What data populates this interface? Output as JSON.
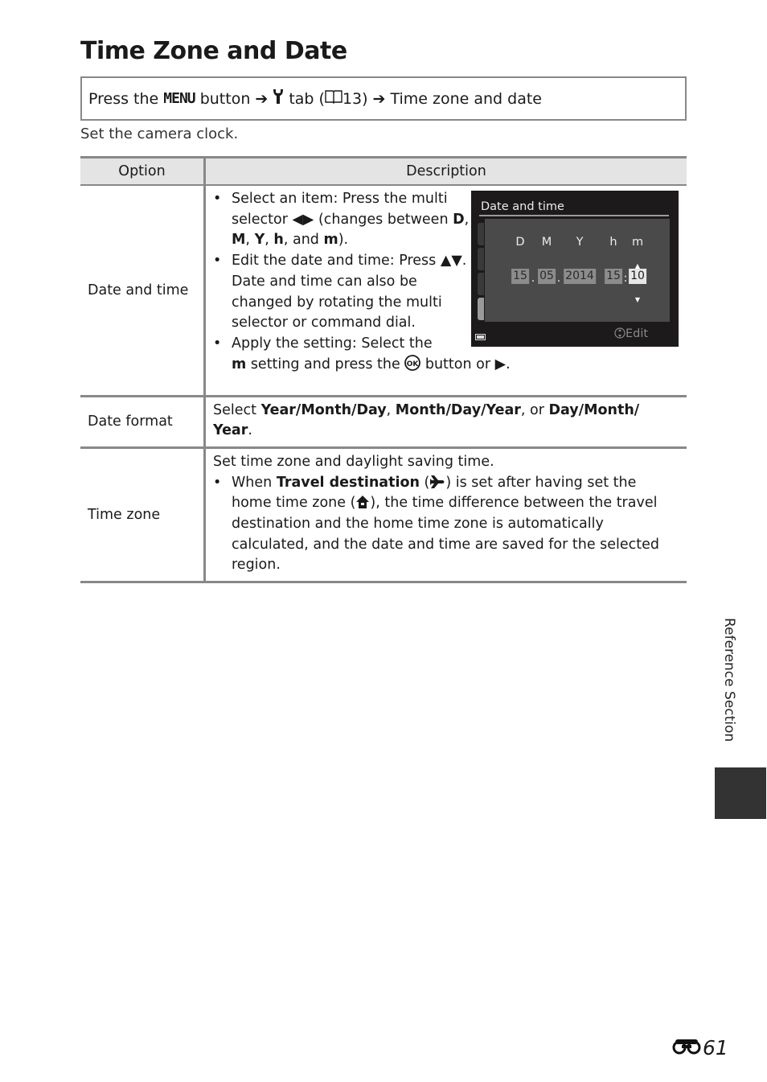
{
  "page": {
    "title": "Time Zone and Date",
    "nav_path": {
      "prefix": "Press the",
      "menu_word": "MENU",
      "button_word": "button",
      "arrow": "➔",
      "tab_icon": "wrench-icon",
      "tab_word": "tab (",
      "book_icon": "book-reference-icon",
      "page_ref": "13)",
      "destination": "Time zone and date"
    },
    "intro": "Set the camera clock.",
    "side_label": "Reference Section",
    "page_number": "61",
    "page_prefix_icon": "binoculars-icon"
  },
  "table": {
    "headers": [
      "Option",
      "Description"
    ],
    "rows": [
      {
        "option": "Date and time",
        "bullets": {
          "b1_a": "Select an item: Press the multi selector ",
          "b1_arrows": "◀▶",
          "b1_b": " (changes between ",
          "b1_D": "D",
          "b1_c1": ", ",
          "b1_M": "M",
          "b1_c2": ", ",
          "b1_Y": "Y",
          "b1_c3": ", ",
          "b1_h": "h",
          "b1_c4": ", and ",
          "b1_m": "m",
          "b1_end": ").",
          "b2_a": "Edit the date and time: Press ",
          "b2_arrows": "▲▼",
          "b2_b": ". Date and time can also be changed by rotating the multi selector or command dial.",
          "b3_a": "Apply the setting: Select the ",
          "b3_m": "m",
          "b3_b": " setting and press the ",
          "b3_ok": "OK",
          "b3_c": " button or ",
          "b3_arrow": "▶",
          "b3_end": "."
        },
        "screen": {
          "title": "Date and time",
          "field_labels": [
            "D",
            "M",
            "Y",
            "h",
            "m"
          ],
          "field_values": [
            "15",
            "05",
            "2014",
            "15",
            "10"
          ],
          "date_separator": ".",
          "time_separator": ":",
          "selected_field": "m",
          "edit_label": "Edit"
        }
      },
      {
        "option": "Date format",
        "text": {
          "a": "Select ",
          "f1": "Year/Month/Day",
          "c1": ", ",
          "f2": "Month/Day/Year",
          "c2": ", or ",
          "f3": "Day/Month/ Year",
          "end": "."
        }
      },
      {
        "option": "Time zone",
        "text": {
          "intro": "Set time zone and daylight saving time.",
          "b1_a": "When ",
          "b1_bold": "Travel destination",
          "b1_b": " (",
          "b1_icon": "airplane-icon",
          "b1_c": ") is set after having set the home time zone (",
          "b1_icon2": "home-icon",
          "b1_d": "), the time difference between the travel destination and the home time zone is automatically calculated, and the date and time are saved for the selected region."
        }
      }
    ]
  }
}
